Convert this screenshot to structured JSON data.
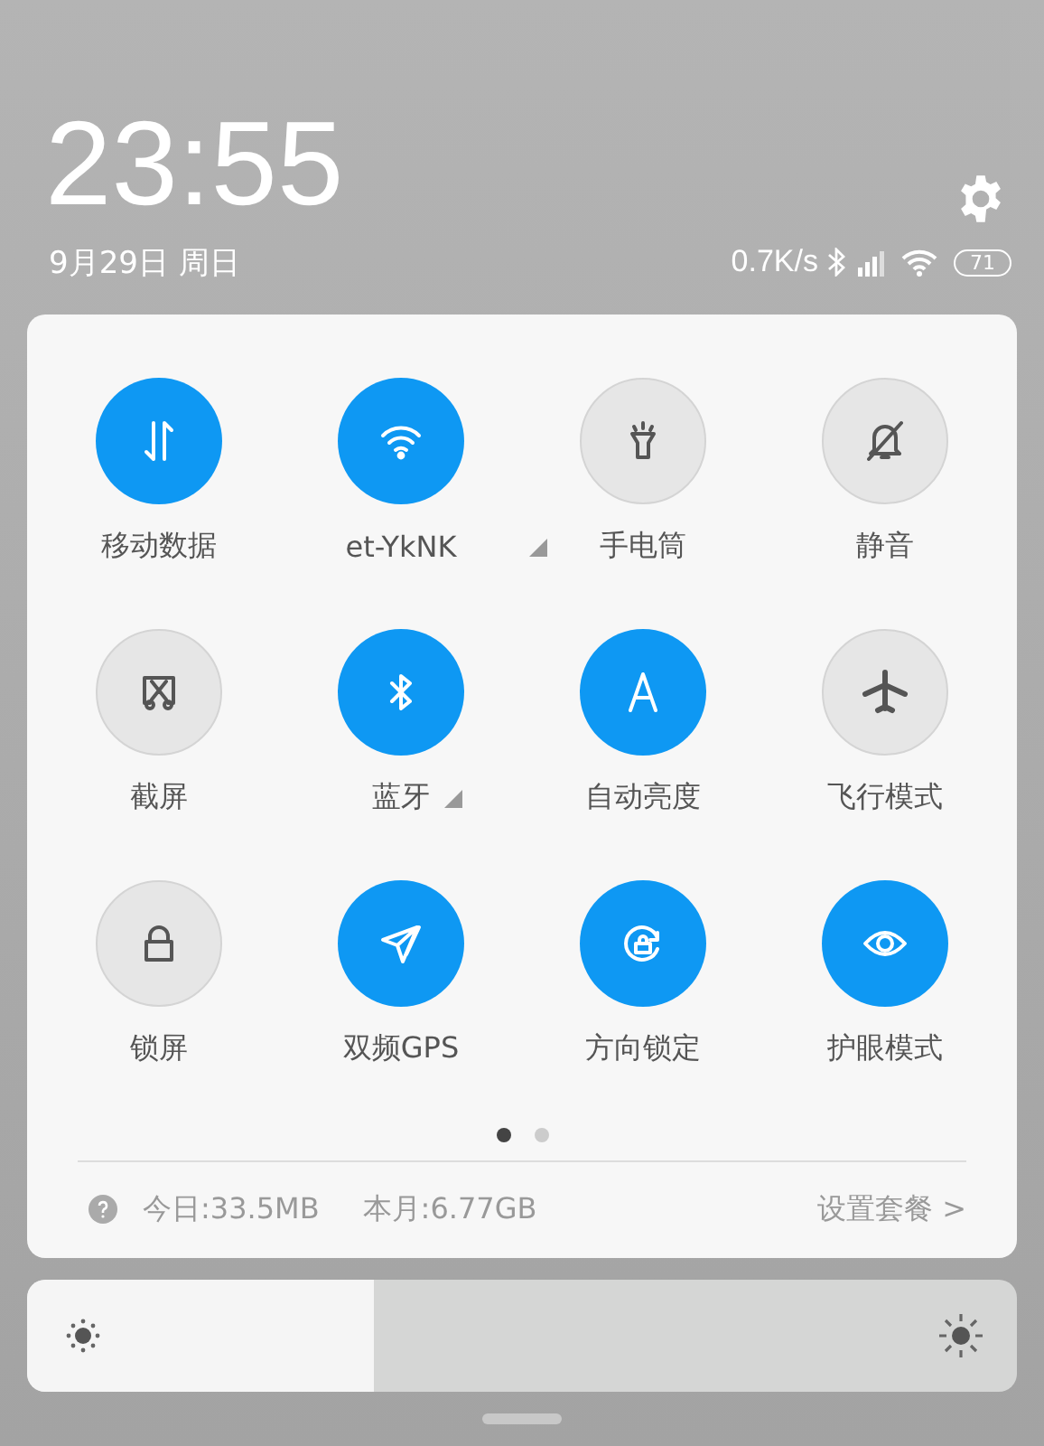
{
  "header": {
    "time": "23:55",
    "date": "9月29日 周日",
    "net_speed": "0.7K/s",
    "battery": "71"
  },
  "tiles": [
    {
      "kind": "data",
      "label": "移动数据",
      "on": true,
      "expandable": false
    },
    {
      "kind": "wifi",
      "label": "et-YkNK",
      "on": true,
      "expandable": true
    },
    {
      "kind": "torch",
      "label": "手电筒",
      "on": false,
      "expandable": false
    },
    {
      "kind": "mute",
      "label": "静音",
      "on": false,
      "expandable": false
    },
    {
      "kind": "screenshot",
      "label": "截屏",
      "on": false,
      "expandable": false
    },
    {
      "kind": "bluetooth",
      "label": "蓝牙",
      "on": true,
      "expandable": true
    },
    {
      "kind": "auto",
      "label": "自动亮度",
      "on": true,
      "expandable": false
    },
    {
      "kind": "plane",
      "label": "飞行模式",
      "on": false,
      "expandable": false
    },
    {
      "kind": "lock",
      "label": "锁屏",
      "on": false,
      "expandable": false
    },
    {
      "kind": "gps",
      "label": "双频GPS",
      "on": true,
      "expandable": false
    },
    {
      "kind": "rotation",
      "label": "方向锁定",
      "on": true,
      "expandable": false
    },
    {
      "kind": "eye",
      "label": "护眼模式",
      "on": true,
      "expandable": false
    }
  ],
  "pages": [
    {
      "selected": true
    },
    {
      "selected": false
    }
  ],
  "usage": {
    "today": "今日:33.5MB",
    "month": "本月:6.77GB",
    "link": "设置套餐 >"
  },
  "brightness": {
    "level": 0.35
  }
}
